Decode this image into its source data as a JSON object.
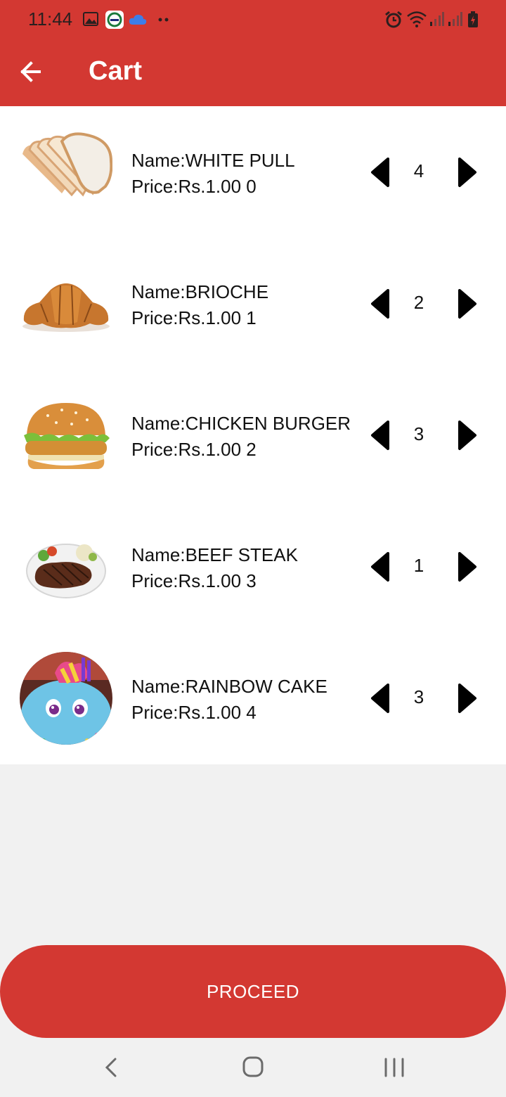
{
  "status_bar": {
    "time": "11:44",
    "icons_left": [
      "image-icon",
      "app-notification-icon",
      "cloud-icon",
      "more-dots-icon"
    ],
    "icons_right": [
      "alarm-icon",
      "wifi-icon",
      "signal-icon",
      "signal-icon",
      "battery-icon"
    ]
  },
  "app_bar": {
    "title": "Cart",
    "back_icon": "arrow-left-icon",
    "background_color": "#d33832"
  },
  "cart": {
    "items": [
      {
        "name": "Name:WHITE PULL",
        "price": "Price:Rs.1.00 0",
        "quantity": "4",
        "image": "white-bread-slices"
      },
      {
        "name": "Name:BRIOCHE",
        "price": "Price:Rs.1.00 1",
        "quantity": "2",
        "image": "croissant"
      },
      {
        "name": "Name:CHICKEN BURGER",
        "price": "Price:Rs.1.00 2",
        "quantity": "3",
        "image": "chicken-burger"
      },
      {
        "name": "Name:BEEF STEAK",
        "price": "Price:Rs.1.00 3",
        "quantity": "1",
        "image": "beef-steak-plate"
      },
      {
        "name": "Name:RAINBOW CAKE",
        "price": "Price:Rs.1.00 4",
        "quantity": "3",
        "image": "rainbow-pony-cake"
      }
    ]
  },
  "proceed_button": {
    "label": "PROCEED"
  },
  "nav_bar": {
    "buttons": [
      "back-icon",
      "home-icon",
      "recents-icon"
    ]
  }
}
